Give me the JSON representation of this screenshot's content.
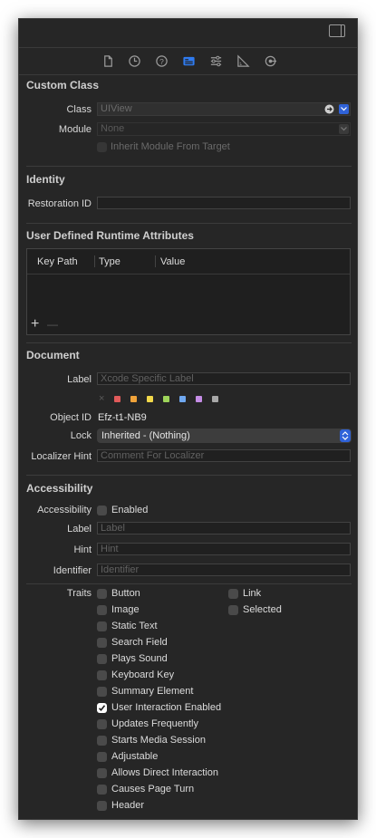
{
  "tabs": [
    "file-inspector-icon",
    "history-icon",
    "help-icon",
    "identity-inspector-icon",
    "attributes-inspector-icon",
    "size-inspector-icon",
    "connections-inspector-icon"
  ],
  "custom_class": {
    "title": "Custom Class",
    "class_label": "Class",
    "class_value": "UIView",
    "module_label": "Module",
    "module_value": "None",
    "inherit_label": "Inherit Module From Target"
  },
  "identity": {
    "title": "Identity",
    "restoration_label": "Restoration ID",
    "restoration_value": ""
  },
  "runtime": {
    "title": "User Defined Runtime Attributes",
    "columns": [
      "Key Path",
      "Type",
      "Value"
    ],
    "add": "+",
    "remove": "—"
  },
  "document": {
    "title": "Document",
    "label_label": "Label",
    "label_placeholder": "Xcode Specific Label",
    "swatch_clear": "×",
    "swatches": [
      "#e05a5a",
      "#f0a33a",
      "#f1d84a",
      "#9ed45a",
      "#6fa8f0",
      "#c58de6",
      "#a8a8a8"
    ],
    "object_id_label": "Object ID",
    "object_id": "Efz-t1-NB9",
    "lock_label": "Lock",
    "lock_value": "Inherited - (Nothing)",
    "localizer_label": "Localizer Hint",
    "localizer_placeholder": "Comment For Localizer"
  },
  "accessibility": {
    "title": "Accessibility",
    "accessibility_label": "Accessibility",
    "enabled_label": "Enabled",
    "label_label": "Label",
    "label_placeholder": "Label",
    "hint_label": "Hint",
    "hint_placeholder": "Hint",
    "identifier_label": "Identifier",
    "identifier_placeholder": "Identifier",
    "traits_label": "Traits",
    "traits_left": [
      {
        "label": "Button",
        "checked": false
      },
      {
        "label": "Image",
        "checked": false
      },
      {
        "label": "Static Text",
        "checked": false
      },
      {
        "label": "Search Field",
        "checked": false
      },
      {
        "label": "Plays Sound",
        "checked": false
      },
      {
        "label": "Keyboard Key",
        "checked": false
      },
      {
        "label": "Summary Element",
        "checked": false
      },
      {
        "label": "User Interaction Enabled",
        "checked": true
      },
      {
        "label": "Updates Frequently",
        "checked": false
      },
      {
        "label": "Starts Media Session",
        "checked": false
      },
      {
        "label": "Adjustable",
        "checked": false
      },
      {
        "label": "Allows Direct Interaction",
        "checked": false
      },
      {
        "label": "Causes Page Turn",
        "checked": false
      },
      {
        "label": "Header",
        "checked": false
      }
    ],
    "traits_right": [
      {
        "label": "Link",
        "checked": false
      },
      {
        "label": "Selected",
        "checked": false
      }
    ]
  }
}
